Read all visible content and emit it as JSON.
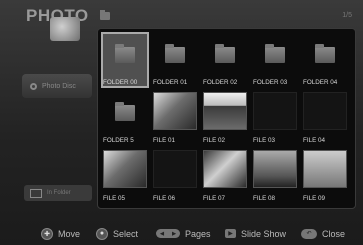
{
  "header": {
    "title": "PHOTO",
    "page_counter": "1/5"
  },
  "sidebar": {
    "source_label": "Photo Disc",
    "footer_label": "In Folder"
  },
  "grid": {
    "items": [
      {
        "name": "FOLDER 00",
        "kind": "folder"
      },
      {
        "name": "FOLDER 01",
        "kind": "folder"
      },
      {
        "name": "FOLDER 02",
        "kind": "folder"
      },
      {
        "name": "FOLDER 03",
        "kind": "folder"
      },
      {
        "name": "FOLDER 04",
        "kind": "folder"
      },
      {
        "name": "FOLDER 5",
        "kind": "folder"
      },
      {
        "name": "FILE 01",
        "kind": "photo"
      },
      {
        "name": "FILE 02",
        "kind": "photo"
      },
      {
        "name": "FILE 03",
        "kind": "blank"
      },
      {
        "name": "FILE 04",
        "kind": "blank"
      },
      {
        "name": "FILE 05",
        "kind": "photo"
      },
      {
        "name": "FILE 06",
        "kind": "blank"
      },
      {
        "name": "FILE 07",
        "kind": "photo"
      },
      {
        "name": "FILE 08",
        "kind": "photo"
      },
      {
        "name": "FILE 09",
        "kind": "photo"
      }
    ],
    "selected_index": 0
  },
  "footer": {
    "move_label": "Move",
    "select_label": "Select",
    "pages_label": "Pages",
    "slideshow_label": "Slide Show",
    "close_label": "Close",
    "move_icon": "dpad-icon",
    "select_icon": "enter-icon",
    "pages_icon": "page-skip-icon",
    "slideshow_icon": "play-icon",
    "close_icon": "return-icon"
  },
  "colors": {
    "background": "#232323",
    "grid_background": "#0c0c0c",
    "selection": "#aaaaaa"
  }
}
